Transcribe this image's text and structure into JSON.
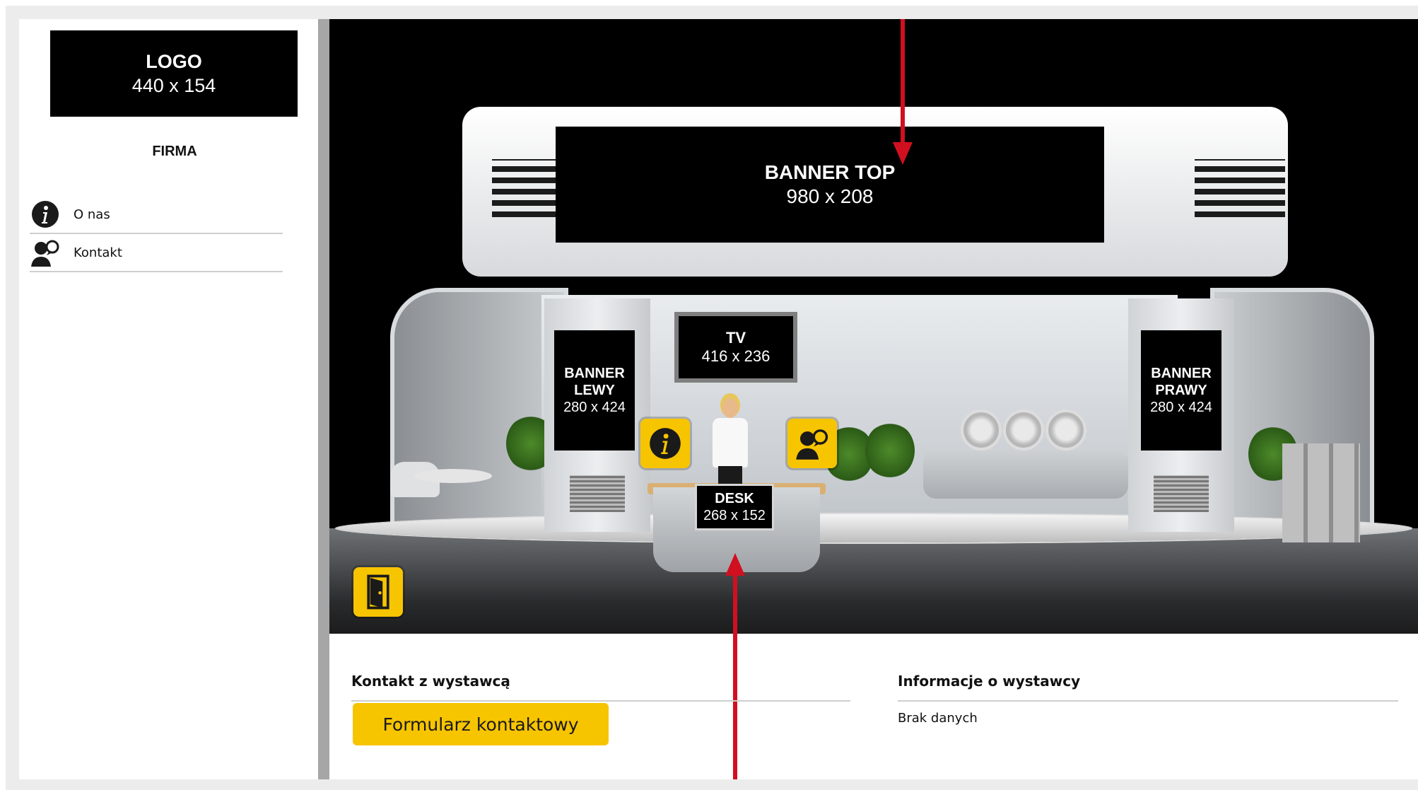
{
  "sidebar": {
    "logo_title": "LOGO",
    "logo_size": "440 x 154",
    "company_name": "FIRMA",
    "menu": [
      {
        "label": "O nas",
        "icon": "info-icon"
      },
      {
        "label": "Kontakt",
        "icon": "contact-person-icon"
      }
    ]
  },
  "booth": {
    "banner_top": {
      "title": "BANNER TOP",
      "size": "980 x 208"
    },
    "banner_left": {
      "title_line1": "BANNER",
      "title_line2": "LEWY",
      "size": "280 x 424"
    },
    "banner_right": {
      "title_line1": "BANNER",
      "title_line2": "PRAWY",
      "size": "280 x 424"
    },
    "tv": {
      "title": "TV",
      "size": "416 x 236"
    },
    "desk": {
      "title": "DESK",
      "size": "268 x 152"
    },
    "info_button_icon": "info-icon",
    "contact_button_icon": "contact-person-icon",
    "exit_button_icon": "door-exit-icon"
  },
  "bottom": {
    "contact_heading": "Kontakt z wystawcą",
    "contact_button_label": "Formularz kontaktowy",
    "info_heading": "Informacje o wystawcy",
    "info_value": "Brak danych"
  },
  "colors": {
    "accent_yellow": "#f7c400",
    "annotation_red": "#d0101f",
    "divider_gray": "#a6a6a6"
  }
}
